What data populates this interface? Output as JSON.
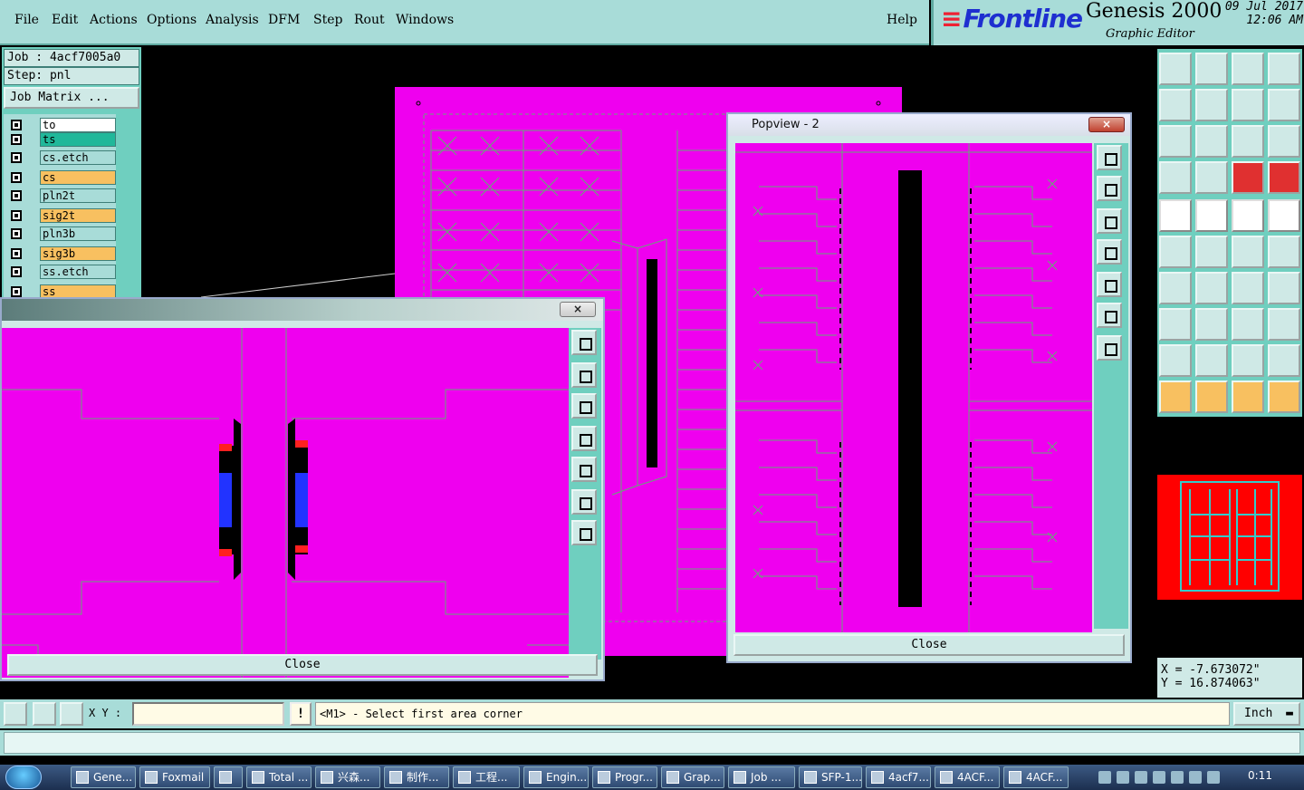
{
  "menu": {
    "items": [
      "File",
      "Edit",
      "Actions",
      "Options",
      "Analysis",
      "DFM",
      "Step",
      "Rout",
      "Windows"
    ],
    "help": "Help"
  },
  "brand": {
    "logo": "Frontline",
    "title": "Genesis 2000",
    "subtitle": "Graphic Editor",
    "date": "09 Jul 2017",
    "time": "12:06 AM"
  },
  "job": {
    "job_label": "Job : 4acf7005a0",
    "step_label": "Step: pnl",
    "matrix_button": "Job Matrix ..."
  },
  "layers": [
    {
      "name": "to",
      "color": "#ffffff"
    },
    {
      "name": "ts",
      "color": "#20b89a"
    },
    {
      "name": "cs.etch",
      "color": "#a8dcd8"
    },
    {
      "name": "cs",
      "color": "#f8c060"
    },
    {
      "name": "pln2t",
      "color": "#a8dcd8"
    },
    {
      "name": "sig2t",
      "color": "#f8c060"
    },
    {
      "name": "pln3b",
      "color": "#a8dcd8"
    },
    {
      "name": "sig3b",
      "color": "#f8c060"
    },
    {
      "name": "ss.etch",
      "color": "#a8dcd8"
    },
    {
      "name": "ss",
      "color": "#f8c060"
    }
  ],
  "popview1": {
    "close_label": "Close",
    "close_x": "×"
  },
  "popview2": {
    "title": "Popview - 2",
    "close_label": "Close",
    "close_x": "×"
  },
  "coords": {
    "x": "X = -7.673072\"",
    "y": "Y = 16.874063\""
  },
  "command": {
    "xy_label": "X Y :",
    "xy_value": "",
    "warn": "!",
    "prompt": "<M1> - Select first area corner",
    "units": "Inch"
  },
  "taskbar": {
    "tasks": [
      "Gene...",
      "Foxmail",
      "",
      "Total ...",
      "兴森...",
      "制作...",
      "工程...",
      "Engin...",
      "Progr...",
      "Grap...",
      "Job ...",
      "SFP-1...",
      "4acf7...",
      "4ACF...",
      "4ACF..."
    ],
    "clock": "0:11"
  },
  "colors": {
    "board": "#ef00ef",
    "panel": "#6fcfbf",
    "menubar": "#a8dcd8",
    "accent_logo": "#1e2fd0"
  }
}
